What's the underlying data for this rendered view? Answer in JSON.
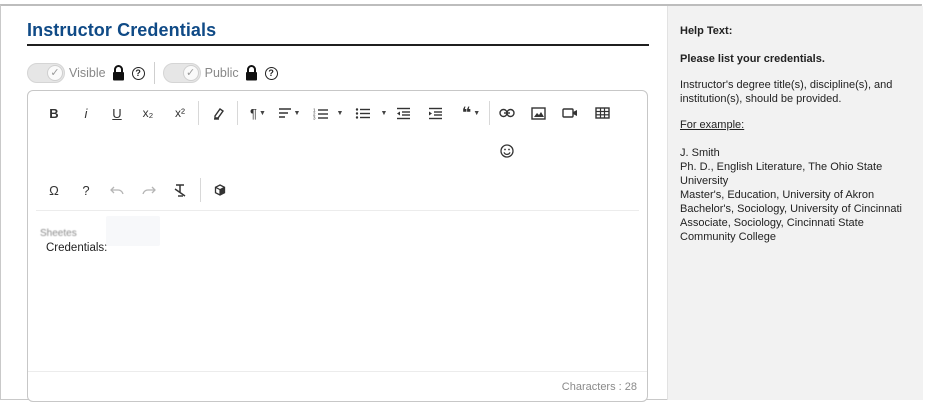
{
  "section": {
    "title": "Instructor Credentials"
  },
  "toggles": {
    "visible_label": "Visible",
    "public_label": "Public",
    "help_glyph": "?",
    "visible_on": false,
    "public_on": false
  },
  "toolbar": {
    "bold": "B",
    "italic": "i",
    "underline": "U",
    "subscript": "x₂",
    "superscript": "x²",
    "paragraph": "¶",
    "omega": "Ω",
    "question": "?",
    "quote": "❝"
  },
  "editor": {
    "faint_text": "Sheetes",
    "line2": "Credentials:",
    "char_count_label": "Characters : 28"
  },
  "help": {
    "heading": "Help Text:",
    "subheading": "Please list your credentials.",
    "body": "Instructor's degree title(s), discipline(s), and institution(s), should be provided.",
    "example_label": "For example:",
    "examples": [
      "J. Smith",
      "Ph. D., English Literature, The Ohio State University",
      "Master's, Education, University of Akron",
      "Bachelor's, Sociology, University of Cincinnati",
      "Associate, Sociology, Cincinnati State Community College"
    ]
  },
  "colors": {
    "title": "#0f4a86",
    "rule": "#1f1f1f",
    "panel": "#f2f2f2"
  }
}
